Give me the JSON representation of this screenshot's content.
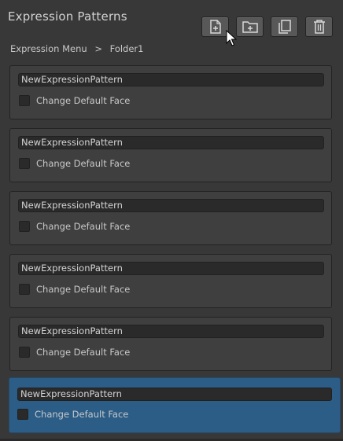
{
  "panel": {
    "title": "Expression Patterns",
    "toolbar": [
      {
        "name": "add-file-button",
        "icon": "file-plus-icon"
      },
      {
        "name": "add-folder-button",
        "icon": "folder-plus-icon"
      },
      {
        "name": "copy-button",
        "icon": "copy-icon"
      },
      {
        "name": "delete-button",
        "icon": "trash-icon"
      }
    ],
    "breadcrumb": [
      "Expression Menu",
      ">",
      "Folder1"
    ],
    "items": [
      {
        "name": "NewExpressionPattern",
        "checkbox_label": "Change Default Face",
        "checked": false,
        "selected": false
      },
      {
        "name": "NewExpressionPattern",
        "checkbox_label": "Change Default Face",
        "checked": false,
        "selected": false
      },
      {
        "name": "NewExpressionPattern",
        "checkbox_label": "Change Default Face",
        "checked": false,
        "selected": false
      },
      {
        "name": "NewExpressionPattern",
        "checkbox_label": "Change Default Face",
        "checked": false,
        "selected": false
      },
      {
        "name": "NewExpressionPattern",
        "checkbox_label": "Change Default Face",
        "checked": false,
        "selected": false
      },
      {
        "name": "NewExpressionPattern",
        "checkbox_label": "Change Default Face",
        "checked": false,
        "selected": true
      }
    ],
    "colors": {
      "background": "#383838",
      "item_background": "#3f3f3f",
      "selected_background": "#2c5d87",
      "field_background": "#2a2a2a"
    }
  }
}
